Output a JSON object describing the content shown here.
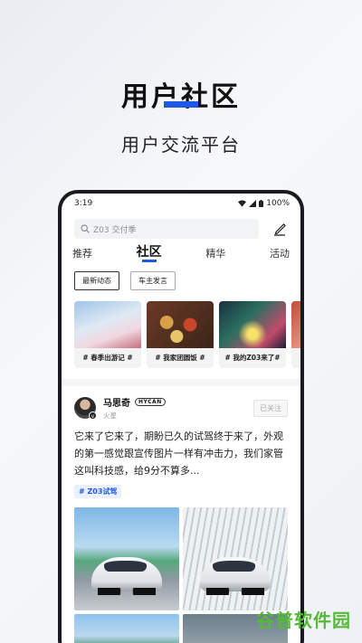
{
  "hero": {
    "title": "用户社区",
    "subtitle": "用户交流平台"
  },
  "status_bar": {
    "time": "3:19",
    "battery": "100%"
  },
  "search": {
    "placeholder": "Z03 交付季"
  },
  "tabs": [
    {
      "label": "推荐",
      "active": false
    },
    {
      "label": "社区",
      "active": true
    },
    {
      "label": "精华",
      "active": false
    },
    {
      "label": "活动",
      "active": false
    }
  ],
  "filters": [
    {
      "label": "最新动态",
      "active": true
    },
    {
      "label": "车主发言",
      "active": false
    }
  ],
  "topics": [
    {
      "label": "# 春季出游记 #"
    },
    {
      "label": "# 我家团圆饭 #"
    },
    {
      "label": "# 我的Z03来了#"
    }
  ],
  "post": {
    "author": "马思奇",
    "brand_tag": "HYCAN",
    "level": "火星",
    "follow_label": "已关注",
    "text": "它来了它来了，期盼已久的试驾终于来了，外观的第一感觉跟宣传图片一样有冲击力，我们家管这叫科技感，给9分不算多...",
    "hashtag": "Z03试驾"
  },
  "watermark": "谷普软件园",
  "colors": {
    "accent": "#1e59e6",
    "watermark": "#57b83a"
  }
}
